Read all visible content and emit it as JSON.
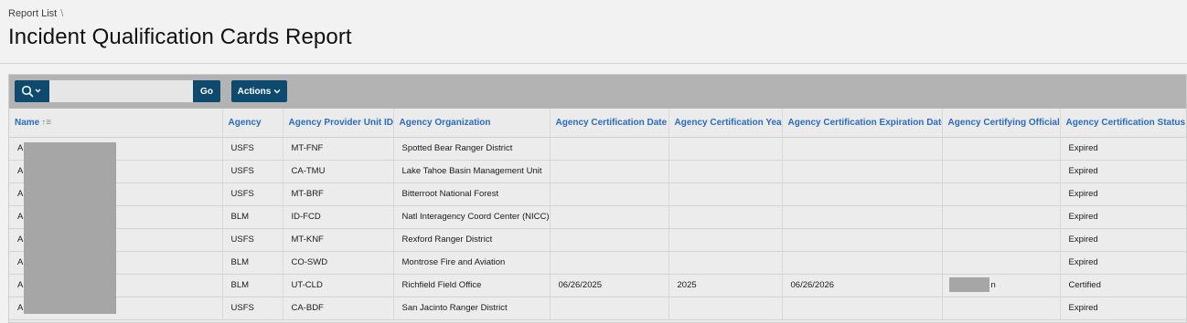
{
  "breadcrumb": {
    "item": "Report List",
    "separator": "\\"
  },
  "page": {
    "title": "Incident Qualification Cards Report"
  },
  "toolbar": {
    "search": {
      "value": "",
      "placeholder": ""
    },
    "go_label": "Go",
    "actions_label": "Actions"
  },
  "colors": {
    "accent": "#0e4a6e",
    "link": "#2a6cc2",
    "toolbar_bg": "#b3b3b3"
  },
  "table": {
    "sort_indicator": "↑≡",
    "columns": [
      "Name",
      "Agency",
      "Agency Provider Unit ID",
      "Agency Organization",
      "Agency Certification Date",
      "Agency Certification Year",
      "Agency Certification Expiration Date",
      "Agency Certifying Official",
      "Agency Certification Status"
    ],
    "rows": [
      [
        "A",
        "USFS",
        "MT-FNF",
        "Spotted Bear Ranger District",
        "",
        "",
        "",
        "",
        "Expired"
      ],
      [
        "A",
        "USFS",
        "CA-TMU",
        "Lake Tahoe Basin Management Unit",
        "",
        "",
        "",
        "",
        "Expired"
      ],
      [
        "A",
        "USFS",
        "MT-BRF",
        "Bitterroot National Forest",
        "",
        "",
        "",
        "",
        "Expired"
      ],
      [
        "A",
        "BLM",
        "ID-FCD",
        "Natl Interagency Coord Center (NICC)",
        "",
        "",
        "",
        "",
        "Expired"
      ],
      [
        "A",
        "USFS",
        "MT-KNF",
        "Rexford Ranger District",
        "",
        "",
        "",
        "",
        "Expired"
      ],
      [
        "A",
        "BLM",
        "CO-SWD",
        "Montrose Fire and Aviation",
        "",
        "",
        "",
        "",
        "Expired"
      ],
      [
        "A",
        "BLM",
        "UT-CLD",
        "Richfield Field Office",
        "06/26/2025",
        "2025",
        "06/26/2026",
        "n",
        "Certified"
      ],
      [
        "A",
        "USFS",
        "CA-BDF",
        "San Jacinto Ranger District",
        "",
        "",
        "",
        "",
        "Expired"
      ]
    ]
  }
}
